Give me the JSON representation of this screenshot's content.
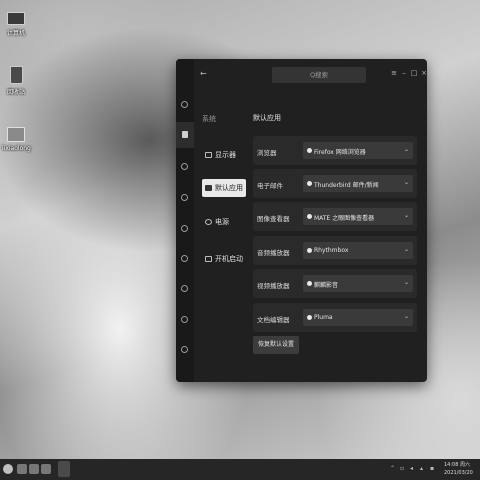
{
  "desktop": {
    "icons": [
      {
        "label": "计算机",
        "icon": "computer-icon"
      },
      {
        "label": "回收站",
        "icon": "trash-icon"
      },
      {
        "label": "lixiaolong",
        "icon": "folder-icon"
      }
    ]
  },
  "window": {
    "search_placeholder": "Q搜索",
    "category": "系统",
    "nav": [
      {
        "label": "显示器",
        "active": false
      },
      {
        "label": "默认应用",
        "active": true
      },
      {
        "label": "电源",
        "active": false
      },
      {
        "label": "开机启动",
        "active": false
      }
    ],
    "panel_title": "默认应用",
    "rows": [
      {
        "label": "浏览器",
        "value": "Firefox 网络浏览器"
      },
      {
        "label": "电子邮件",
        "value": "Thunderbird 邮件/新闻"
      },
      {
        "label": "图像查看器",
        "value": "MATE 之眼图像查看器"
      },
      {
        "label": "音频播放器",
        "value": "Rhythmbox"
      },
      {
        "label": "视频播放器",
        "value": "麒麟影音"
      },
      {
        "label": "文档编辑器",
        "value": "Pluma"
      }
    ],
    "reset_label": "恢复默认设置"
  },
  "taskbar": {
    "time": "14:08 周六",
    "date": "2021/03/20"
  },
  "colors": {
    "window_bg": "#202020",
    "row_bg": "#2a2a2a",
    "active_nav": "#e8e8e8",
    "taskbar_bg": "#262626"
  }
}
